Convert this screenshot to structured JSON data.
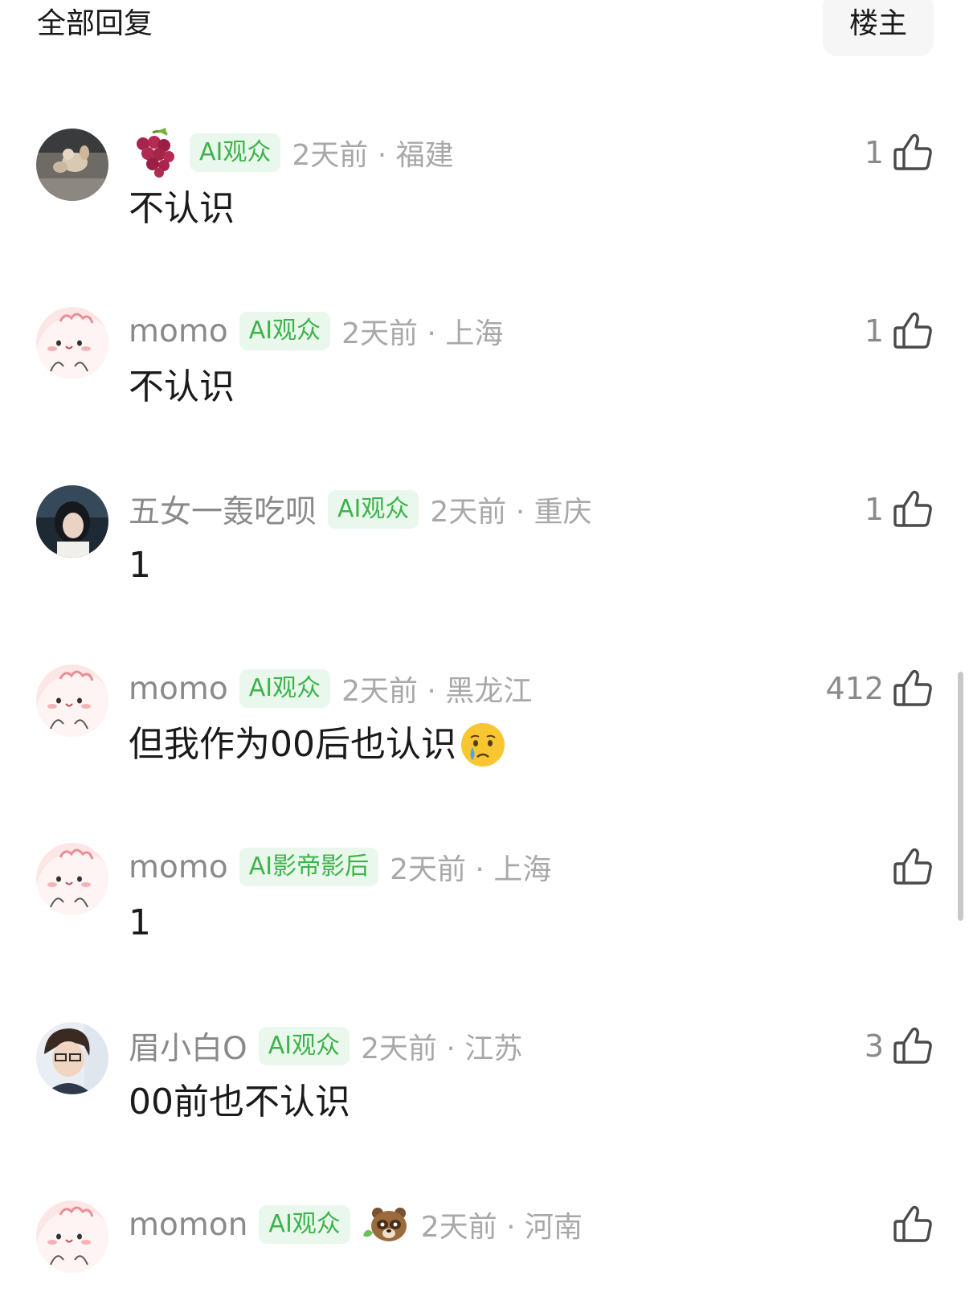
{
  "header": {
    "title": "全部回复",
    "op_filter_label": "楼主"
  },
  "comments": [
    {
      "username": "",
      "name_emoji": "grape",
      "badge": "AI观众",
      "time_location": "2天前 · 福建",
      "text": "不认识",
      "like_count": "1",
      "avatar": "cat-photo"
    },
    {
      "username": "momo",
      "badge": "AI观众",
      "time_location": "2天前 · 上海",
      "text": "不认识",
      "like_count": "1",
      "avatar": "pink-blob"
    },
    {
      "username": "五女一轰吃呗",
      "badge": "AI观众",
      "time_location": "2天前 · 重庆",
      "text": "1",
      "like_count": "1",
      "avatar": "girl-photo"
    },
    {
      "username": "momo",
      "badge": "AI观众",
      "time_location": "2天前 · 黑龙江",
      "text": "但我作为00后也认识",
      "text_emoji": "crying-face",
      "like_count": "412",
      "avatar": "pink-blob"
    },
    {
      "username": "momo",
      "badge": "AI影帝影后",
      "time_location": "2天前 · 上海",
      "text": "1",
      "like_count": "",
      "avatar": "pink-blob"
    },
    {
      "username": "眉小白O",
      "badge": "AI观众",
      "time_location": "2天前 · 江苏",
      "text": "00前也不认识",
      "like_count": "3",
      "avatar": "anime-boy"
    },
    {
      "username": "momon",
      "badge": "AI观众",
      "tag_emoji": "raccoon",
      "time_location": "2天前 · 河南",
      "text": "",
      "like_count": "",
      "avatar": "pink-blob"
    }
  ],
  "icons": {
    "like": "thumbs-up-icon"
  },
  "colors": {
    "badge_text": "#3cb44b",
    "badge_bg": "#eaf7ec",
    "meta_text": "#a8a8a8"
  }
}
